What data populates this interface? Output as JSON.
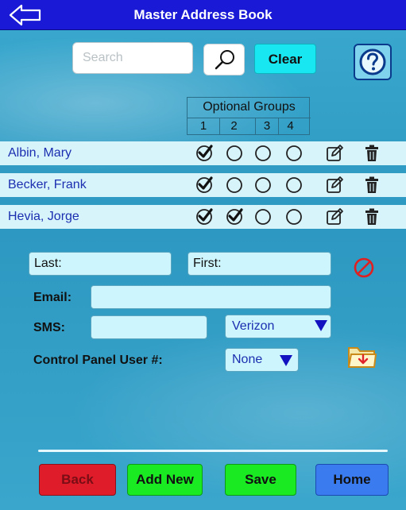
{
  "header": {
    "title": "Master Address Book"
  },
  "search": {
    "placeholder": "Search",
    "clear_label": "Clear"
  },
  "groups": {
    "title": "Optional Groups",
    "numbers": [
      "1",
      "2",
      "3",
      "4"
    ]
  },
  "contacts": [
    {
      "name": "Albin, Mary",
      "groups": [
        true,
        false,
        false,
        false
      ]
    },
    {
      "name": "Becker,  Frank",
      "groups": [
        true,
        false,
        false,
        false
      ]
    },
    {
      "name": "Hevia, Jorge",
      "groups": [
        true,
        true,
        false,
        false
      ]
    }
  ],
  "form": {
    "last_label": "Last:",
    "first_label": "First:",
    "email_label": "Email:",
    "sms_label": "SMS:",
    "carrier_value": "Verizon",
    "panel_user_label": "Control Panel User #:",
    "panel_user_value": "None"
  },
  "buttons": {
    "back": "Back",
    "add_new": "Add New",
    "save": "Save",
    "home": "Home"
  },
  "colors": {
    "titlebar": "#1a1ad6",
    "name_text": "#1b2fb0",
    "back": "#df1c2a",
    "add_save": "#19ea22",
    "home": "#3a7bf0",
    "clear": "#18e6f1"
  },
  "icons": [
    "back-arrow-icon",
    "magnifier-icon",
    "help-icon",
    "checkmark-icon",
    "radio-empty-icon",
    "edit-icon",
    "trash-icon",
    "no-entry-icon",
    "folder-download-icon",
    "dropdown-triangle-icon"
  ]
}
